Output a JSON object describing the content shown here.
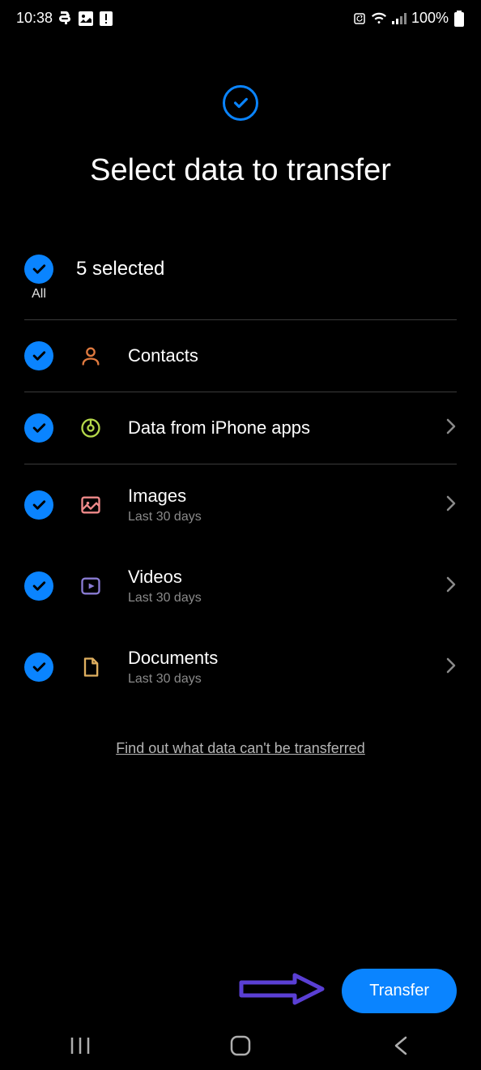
{
  "status_bar": {
    "time": "10:38",
    "battery_text": "100%"
  },
  "header": {
    "title": "Select data to transfer"
  },
  "all": {
    "label": "All",
    "count_text": "5 selected"
  },
  "items": [
    {
      "label": "Contacts",
      "sub": "",
      "has_sub": false,
      "has_chevron": false,
      "bordered": true,
      "icon": "contacts",
      "icon_color": "#e07a3f"
    },
    {
      "label": "Data from iPhone apps",
      "sub": "",
      "has_sub": false,
      "has_chevron": true,
      "bordered": true,
      "icon": "apps",
      "icon_color": "#b5d84a"
    },
    {
      "label": "Images",
      "sub": "Last 30 days",
      "has_sub": true,
      "has_chevron": true,
      "bordered": false,
      "icon": "images",
      "icon_color": "#f08a8a"
    },
    {
      "label": "Videos",
      "sub": "Last 30 days",
      "has_sub": true,
      "has_chevron": true,
      "bordered": false,
      "icon": "videos",
      "icon_color": "#8a7cd4"
    },
    {
      "label": "Documents",
      "sub": "Last 30 days",
      "has_sub": true,
      "has_chevron": true,
      "bordered": false,
      "icon": "documents",
      "icon_color": "#e0b060"
    }
  ],
  "footer": {
    "link_text": "Find out what data can't be transferred"
  },
  "transfer_btn": "Transfer"
}
